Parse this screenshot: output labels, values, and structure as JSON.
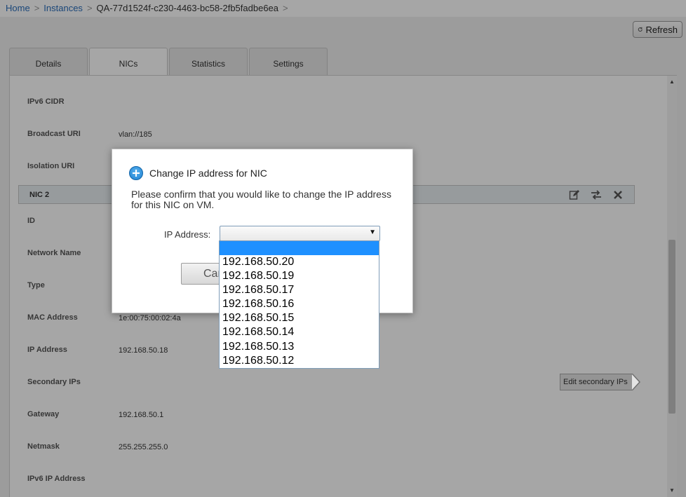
{
  "breadcrumb": {
    "home": "Home",
    "instances": "Instances",
    "current": "QA-77d1524f-c230-4463-bc58-2fb5fadbe6ea",
    "sep": ">"
  },
  "toolbar": {
    "refresh_label": "Refresh"
  },
  "tabs": [
    {
      "label": "Details"
    },
    {
      "label": "NICs"
    },
    {
      "label": "Statistics"
    },
    {
      "label": "Settings"
    }
  ],
  "nic1": {
    "ipv6_cidr_label": "IPv6 CIDR",
    "broadcast_uri_label": "Broadcast URI",
    "broadcast_uri_value": "vlan://185",
    "isolation_uri_label": "Isolation URI"
  },
  "nic2": {
    "header": "NIC 2",
    "rows": {
      "id_label": "ID",
      "network_name_label": "Network Name",
      "type_label": "Type",
      "mac_label": "MAC Address",
      "mac_value": "1e:00:75:00:02:4a",
      "ip_label": "IP Address",
      "ip_value": "192.168.50.18",
      "secondary_label": "Secondary IPs",
      "gateway_label": "Gateway",
      "gateway_value": "192.168.50.1",
      "netmask_label": "Netmask",
      "netmask_value": "255.255.255.0",
      "ipv6_label": "IPv6 IP Address"
    },
    "edit_secondary_label": "Edit secondary IPs"
  },
  "dialog": {
    "title": "Change IP address for NIC",
    "message": "Please confirm that you would like to change the IP address for this NIC on VM.",
    "ip_label": "IP Address:",
    "selected_value": "",
    "cancel_label": "Car",
    "options": [
      "",
      "192.168.50.20",
      "192.168.50.19",
      "192.168.50.17",
      "192.168.50.16",
      "192.168.50.15",
      "192.168.50.14",
      "192.168.50.13",
      "192.168.50.12"
    ]
  },
  "colors": {
    "link": "#2a6ebb",
    "selected_option": "#1e90ff",
    "overlay": "rgba(0,0,0,0.35)"
  }
}
